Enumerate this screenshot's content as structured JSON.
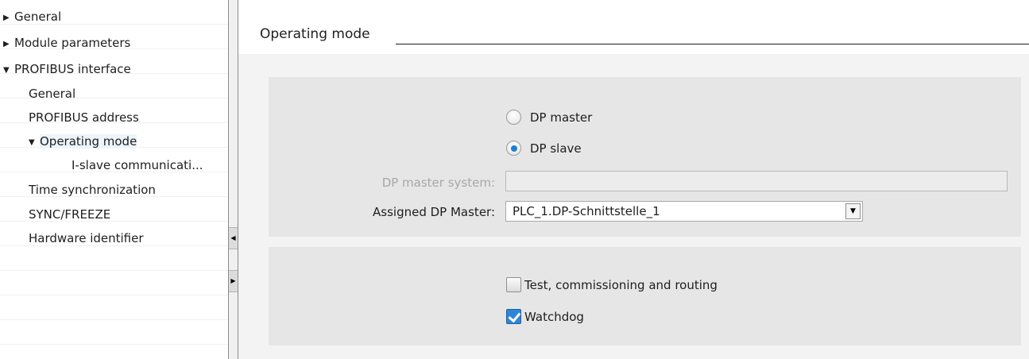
{
  "tree": {
    "items": [
      {
        "label": "General",
        "arrow": "▶"
      },
      {
        "label": "Module parameters",
        "arrow": "▶"
      },
      {
        "label": "PROFIBUS interface",
        "arrow": "▼"
      },
      {
        "label": "General"
      },
      {
        "label": "PROFIBUS address"
      },
      {
        "label": "Operating mode",
        "arrow": "▼"
      },
      {
        "label": "I-slave communicati..."
      },
      {
        "label": "Time synchronization"
      },
      {
        "label": "SYNC/FREEZE"
      },
      {
        "label": "Hardware identifier"
      }
    ]
  },
  "splitter": {
    "collapse_glyph": "◀",
    "expand_glyph": "▶"
  },
  "main": {
    "section_title": "Operating mode",
    "mode": {
      "radio_master": {
        "label": "DP master",
        "selected": false
      },
      "radio_slave": {
        "label": "DP slave",
        "selected": true
      },
      "dp_master_system_label": "DP master system:",
      "dp_master_system_value": "",
      "assigned_label": "Assigned DP Master:",
      "assigned_value": "PLC_1.DP-Schnittstelle_1",
      "dropdown_glyph": "▼"
    },
    "options": {
      "test_label": "Test, commissioning and routing",
      "test_checked": false,
      "watchdog_label": "Watchdog",
      "watchdog_checked": true
    }
  },
  "colors": {
    "panel_bg": "#e6e6e6",
    "main_bg": "#f3f3f3",
    "accent": "#2f86d8",
    "disabled_text": "#a8a8a8"
  }
}
